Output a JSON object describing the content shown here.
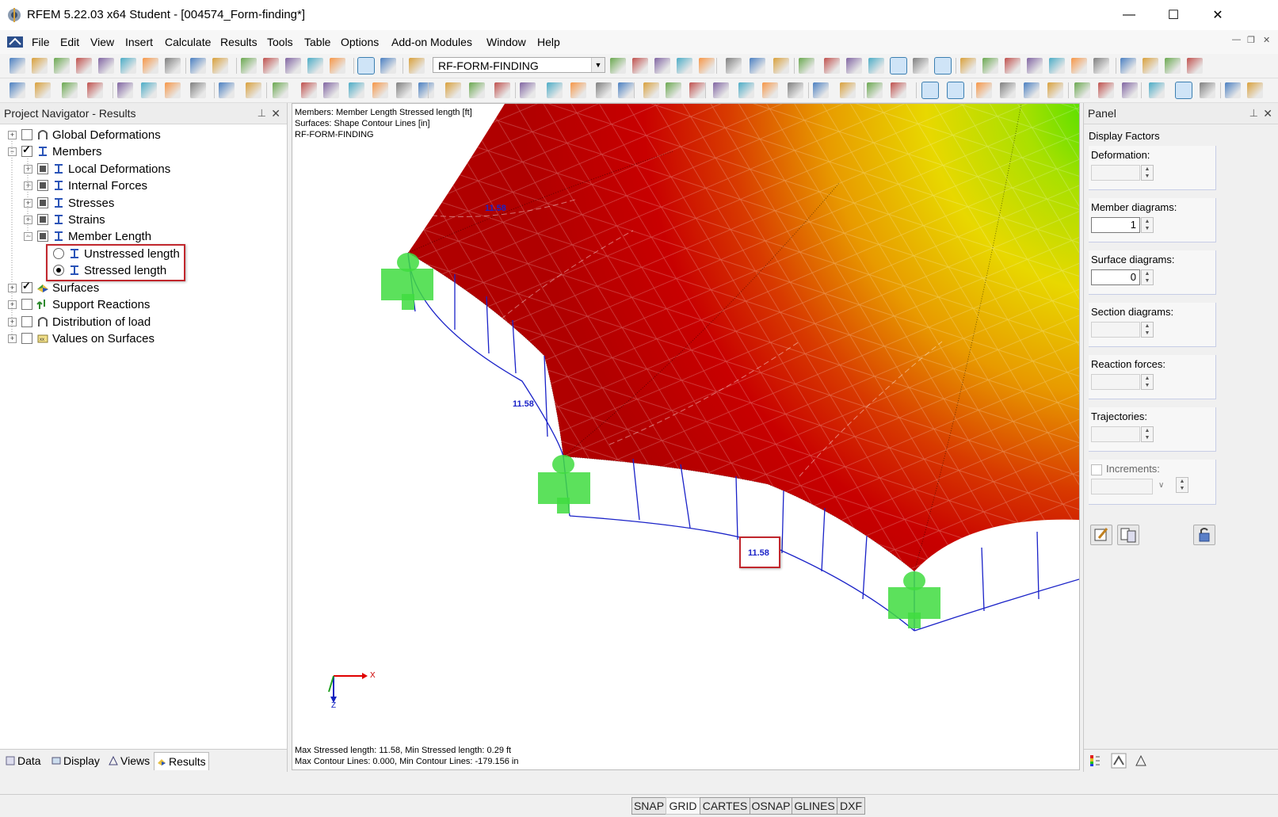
{
  "window": {
    "title": "RFEM 5.22.03 x64 Student - [004574_Form-finding*]",
    "controls": {
      "minimize": "—",
      "maximize": "☐",
      "close": "✕"
    }
  },
  "menu": [
    "File",
    "Edit",
    "View",
    "Insert",
    "Calculate",
    "Results",
    "Tools",
    "Table",
    "Options",
    "Add-on Modules",
    "Window",
    "Help"
  ],
  "toolbar": {
    "load_case_combo": "RF-FORM-FINDING"
  },
  "navigator": {
    "title": "Project Navigator - Results",
    "items": {
      "global_deformations": "Global Deformations",
      "members": "Members",
      "local_deformations": "Local Deformations",
      "internal_forces": "Internal Forces",
      "stresses": "Stresses",
      "strains": "Strains",
      "member_length": "Member Length",
      "unstressed_length": "Unstressed length",
      "stressed_length": "Stressed length",
      "surfaces": "Surfaces",
      "support_reactions": "Support Reactions",
      "distribution_of_load": "Distribution of load",
      "values_on_surfaces": "Values on Surfaces"
    },
    "tabs": {
      "data": "Data",
      "display": "Display",
      "views": "Views",
      "results": "Results"
    }
  },
  "viewport": {
    "info_line1": "Members: Member Length Stressed length [ft]",
    "info_line2": "Surfaces: Shape Contour Lines [in]",
    "info_line3": "RF-FORM-FINDING",
    "footer_line1": "Max Stressed length: 11.58, Min Stressed length: 0.29 ft",
    "footer_line2": "Max Contour Lines: 0.000, Min Contour Lines: -179.156 in",
    "labels": {
      "top": "11.58",
      "left": "11.58",
      "boxed": "11.58"
    },
    "axes": {
      "x": "X",
      "z": "Z"
    }
  },
  "panel": {
    "title": "Panel",
    "display_factors": "Display Factors",
    "deformation": {
      "label": "Deformation:",
      "value": ""
    },
    "member_diagrams": {
      "label": "Member diagrams:",
      "value": "1"
    },
    "surface_diagrams": {
      "label": "Surface diagrams:",
      "value": "0"
    },
    "section_diagrams": {
      "label": "Section diagrams:",
      "value": ""
    },
    "reaction_forces": {
      "label": "Reaction forces:",
      "value": ""
    },
    "trajectories": {
      "label": "Trajectories:",
      "value": ""
    },
    "increments": {
      "label": "Increments:"
    }
  },
  "statusbar": {
    "snap": "SNAP",
    "grid": "GRID",
    "cartes": "CARTES",
    "osnap": "OSNAP",
    "glines": "GLINES",
    "dxf": "DXF"
  },
  "colors": {
    "highlight": "#c1272d",
    "result_label": "#1a22c8",
    "support": "#3fdc3f",
    "surface_red": "#c30000"
  }
}
